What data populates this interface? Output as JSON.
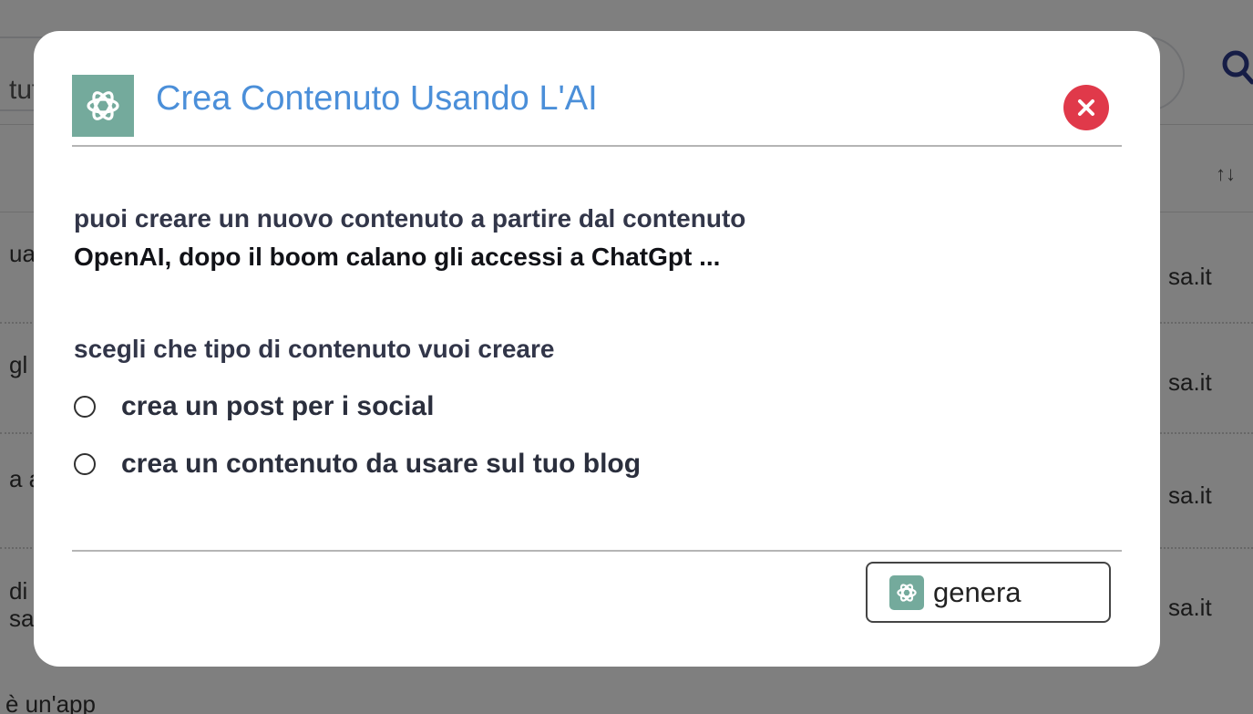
{
  "background": {
    "search_text": "tut",
    "rows": [
      {
        "left_text": [
          "ua"
        ],
        "domain": "sa.it"
      },
      {
        "left_text": [
          "gl"
        ],
        "domain": "sa.it"
      },
      {
        "left_text": [
          "a a"
        ],
        "domain": "sa.it"
      },
      {
        "left_text": [
          "di",
          "sa"
        ],
        "domain": "sa.it"
      }
    ],
    "bottom_text": "è un'app"
  },
  "modal": {
    "title": "Crea Contenuto Usando L'AI",
    "intro_line1": "puoi creare un nuovo contenuto a partire dal contenuto",
    "intro_line2": "OpenAI, dopo il boom calano gli accessi a ChatGpt ...",
    "choose_label": "scegli che tipo di contenuto vuoi creare",
    "options": [
      {
        "label": "crea un post per i social",
        "selected": false
      },
      {
        "label": "crea un contenuto da usare sul tuo blog",
        "selected": false
      }
    ],
    "generate_label": "genera",
    "icons": {
      "logo": "openai-logo-icon",
      "close": "close-icon"
    },
    "colors": {
      "title": "#4b8fd9",
      "close": "#e0394a",
      "logo_bg": "#74aa9c"
    }
  }
}
